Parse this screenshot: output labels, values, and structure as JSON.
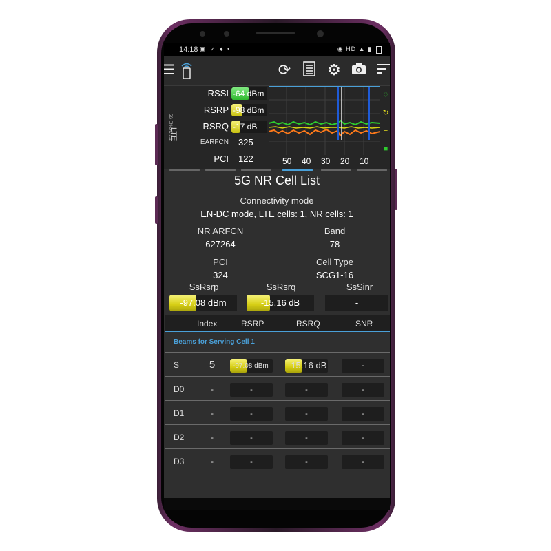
{
  "status_bar": {
    "time": "14:18",
    "left_icons": "▣ ✓ ♦ •",
    "right_icons": "◉ HD ▲ ▮"
  },
  "toolbar": {
    "icons": [
      "menu-icon",
      "signal-phone-icon",
      "refresh-icon",
      "log-icon",
      "settings-icon",
      "camera-icon",
      "sort-icon"
    ]
  },
  "lte": {
    "tech_label": "LTE",
    "sub_label": "5G EN-DC 1:1",
    "rssi_label": "RSSI",
    "rssi_value": "-64 dBm",
    "rssi_level": 0.5,
    "rsrp_label": "RSRP",
    "rsrp_value": "-98 dBm",
    "rsrp_level": 0.3,
    "rsrq_label": "RSRQ",
    "rsrq_value": "-17 dB",
    "rsrq_level": 0.25,
    "earfcn_label": "EARFCN",
    "earfcn_value": "325",
    "pci_label": "PCI",
    "pci_value": "122",
    "graph_x_labels": [
      "50",
      "40",
      "30",
      "20",
      "10"
    ],
    "colors": {
      "rssi": "#39c739",
      "rsrp": "#d8d40f",
      "rsrq": "#d8d40f",
      "graph_green": "#2ecc2e",
      "graph_orange": "#ff7a1a",
      "graph_blue": "#1f5bd6"
    }
  },
  "main": {
    "title": "5G NR Cell List",
    "connectivity_label": "Connectivity mode",
    "connectivity_value": "EN-DC mode, LTE cells: 1, NR cells: 1",
    "nr_arfcn_label": "NR ARFCN",
    "nr_arfcn_value": "627264",
    "band_label": "Band",
    "band_value": "78",
    "pci_label": "PCI",
    "pci_value": "324",
    "cell_type_label": "Cell Type",
    "cell_type_value": "SCG1-16",
    "ssrsrp_label": "SsRsrp",
    "ssrsrp_value": "-97.08 dBm",
    "ssrsrp_level": 0.4,
    "ssrsrq_label": "SsRsrq",
    "ssrsrq_value": "-15.16 dB",
    "ssrsrq_level": 0.35,
    "sssinr_label": "SsSinr",
    "sssinr_value": "-"
  },
  "table": {
    "headers": [
      "Index",
      "RSRP",
      "RSRQ",
      "SNR"
    ],
    "section_label": "Beams for Serving Cell 1",
    "rows": [
      {
        "label": "S",
        "index": "5",
        "rsrp": "-97.08 dBm",
        "rsrp_level": 0.4,
        "rsrq": "-15.16 dB",
        "rsrq_level": 0.4,
        "snr": "-"
      },
      {
        "label": "D0",
        "index": "-",
        "rsrp": "-",
        "rsrq": "-",
        "snr": "-"
      },
      {
        "label": "D1",
        "index": "-",
        "rsrp": "-",
        "rsrq": "-",
        "snr": "-"
      },
      {
        "label": "D2",
        "index": "-",
        "rsrp": "-",
        "rsrq": "-",
        "snr": "-"
      },
      {
        "label": "D3",
        "index": "-",
        "rsrp": "-",
        "rsrq": "-",
        "snr": "-"
      }
    ]
  }
}
